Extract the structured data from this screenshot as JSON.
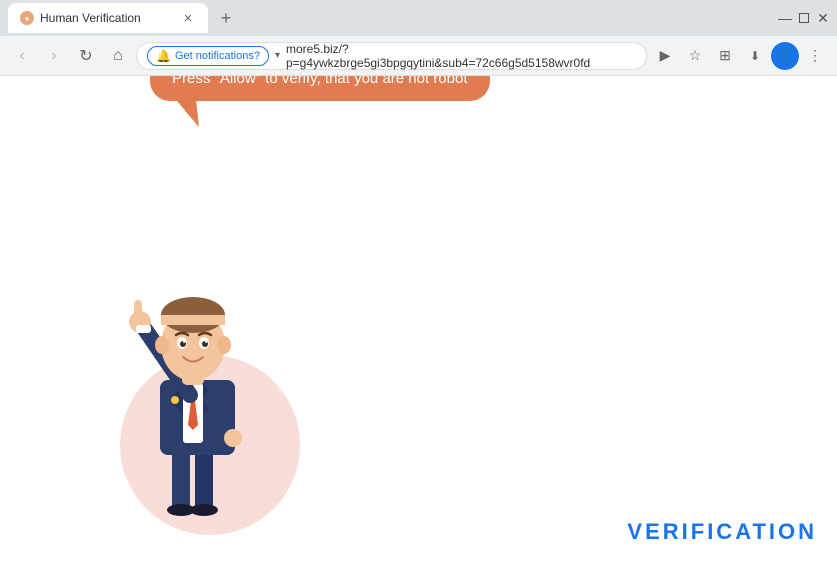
{
  "browser": {
    "tab": {
      "title": "Human Verification",
      "favicon_color": "#e8a87c"
    },
    "new_tab_label": "+",
    "window_controls": {
      "minimize": "—",
      "maximize": "",
      "close": "✕"
    },
    "nav": {
      "back_label": "‹",
      "forward_label": "›",
      "reload_label": "↻",
      "home_label": "⌂"
    },
    "notification_label": "Get notifications?",
    "address": "more5.biz/?p=g4ywkzbrge5gi3bpgqytini&sub4=72c66g5d5158wvr0fd",
    "toolbar_icons": {
      "cast": "▶",
      "star": "★",
      "puzzle": "⊞",
      "person_outline": "👤",
      "profile": "👤",
      "menu": "⋮"
    }
  },
  "page": {
    "speech_bubble_text": "Press \"Allow\" to verify, that you are not robot",
    "verification_watermark": "VERIFICATION"
  }
}
